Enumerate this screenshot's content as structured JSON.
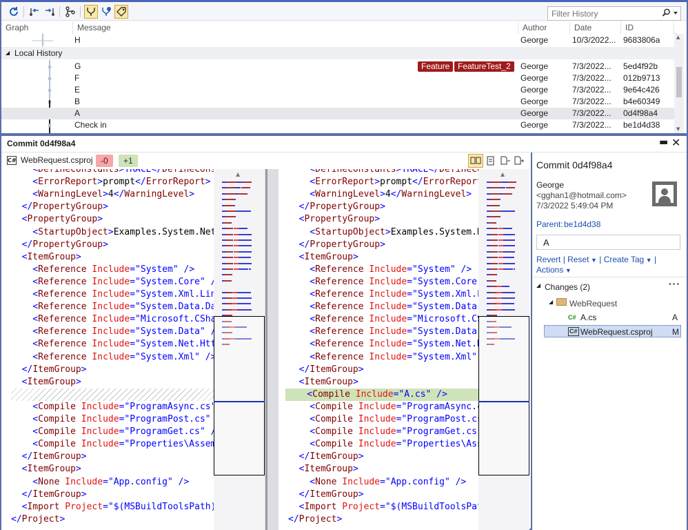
{
  "toolbar": {
    "filter_placeholder": "Filter History",
    "icons": [
      "refresh-icon",
      "go-to-parent-icon",
      "go-to-child-icon",
      "branch-graph-icon",
      "show-remote-icon",
      "show-local-icon",
      "show-tags-icon",
      "search-icon"
    ]
  },
  "history": {
    "columns": [
      "Graph",
      "Message",
      "Author",
      "Date",
      "ID"
    ],
    "top_row": {
      "message": "H",
      "author": "George",
      "date": "10/3/2022...",
      "id": "9683806a"
    },
    "group_label": "Local History",
    "rows": [
      {
        "message": "G",
        "author": "George",
        "date": "7/3/2022...",
        "id": "5ed4f92b",
        "tags": [
          "Feature",
          "FeatureTest_2"
        ]
      },
      {
        "message": "F",
        "author": "George",
        "date": "7/3/2022...",
        "id": "012b9713",
        "tags": []
      },
      {
        "message": "E",
        "author": "George",
        "date": "7/3/2022...",
        "id": "9e64c426",
        "tags": []
      },
      {
        "message": "B",
        "author": "George",
        "date": "7/3/2022...",
        "id": "b4e60349",
        "tags": []
      },
      {
        "message": "A",
        "author": "George",
        "date": "7/3/2022...",
        "id": "0d4f98a4",
        "tags": [],
        "selected": true
      },
      {
        "message": "Check in",
        "author": "George",
        "date": "7/3/2022...",
        "id": "be1d4d38",
        "tags": []
      }
    ]
  },
  "commit_panel": {
    "title": "Commit 0d4f98a4",
    "file_name": "WebRequest.csproj",
    "removed_badge": "-0",
    "added_badge": "+1"
  },
  "diff": {
    "left": [
      [
        [
          "    <",
          "b"
        ],
        [
          "DefineConstants",
          "k"
        ],
        [
          ">TRACE</",
          "b"
        ],
        [
          "DefineConst",
          "k"
        ]
      ],
      [
        [
          "    <",
          "b"
        ],
        [
          "ErrorReport",
          "k"
        ],
        [
          ">",
          "b"
        ],
        [
          "prompt",
          "tx"
        ],
        [
          "</",
          "b"
        ],
        [
          "ErrorReport",
          "k"
        ],
        [
          ">",
          "b"
        ]
      ],
      [
        [
          "    <",
          "b"
        ],
        [
          "WarningLevel",
          "k"
        ],
        [
          ">",
          "b"
        ],
        [
          "4",
          "tx"
        ],
        [
          "</",
          "b"
        ],
        [
          "WarningLevel",
          "k"
        ],
        [
          ">",
          "b"
        ]
      ],
      [
        [
          "  </",
          "b"
        ],
        [
          "PropertyGroup",
          "k"
        ],
        [
          ">",
          "b"
        ]
      ],
      [
        [
          "  <",
          "b"
        ],
        [
          "PropertyGroup",
          "k"
        ],
        [
          ">",
          "b"
        ]
      ],
      [
        [
          "    <",
          "b"
        ],
        [
          "StartupObject",
          "k"
        ],
        [
          ">",
          "b"
        ],
        [
          "Examples.System.Net",
          "tx"
        ]
      ],
      [
        [
          "  </",
          "b"
        ],
        [
          "PropertyGroup",
          "k"
        ],
        [
          ">",
          "b"
        ]
      ],
      [
        [
          "  <",
          "b"
        ],
        [
          "ItemGroup",
          "k"
        ],
        [
          ">",
          "b"
        ]
      ],
      [
        [
          "    <",
          "b"
        ],
        [
          "Reference",
          "k"
        ],
        [
          " ",
          "tx"
        ],
        [
          "Include",
          "a"
        ],
        [
          "=",
          "b"
        ],
        [
          "\"System\"",
          "s"
        ],
        [
          " />",
          "b"
        ]
      ],
      [
        [
          "    <",
          "b"
        ],
        [
          "Reference",
          "k"
        ],
        [
          " ",
          "tx"
        ],
        [
          "Include",
          "a"
        ],
        [
          "=",
          "b"
        ],
        [
          "\"System.Core\"",
          "s"
        ],
        [
          " />",
          "b"
        ]
      ],
      [
        [
          "    <",
          "b"
        ],
        [
          "Reference",
          "k"
        ],
        [
          " ",
          "tx"
        ],
        [
          "Include",
          "a"
        ],
        [
          "=",
          "b"
        ],
        [
          "\"System.Xml.Linq",
          "s"
        ]
      ],
      [
        [
          "    <",
          "b"
        ],
        [
          "Reference",
          "k"
        ],
        [
          " ",
          "tx"
        ],
        [
          "Include",
          "a"
        ],
        [
          "=",
          "b"
        ],
        [
          "\"System.Data.Dat",
          "s"
        ]
      ],
      [
        [
          "    <",
          "b"
        ],
        [
          "Reference",
          "k"
        ],
        [
          " ",
          "tx"
        ],
        [
          "Include",
          "a"
        ],
        [
          "=",
          "b"
        ],
        [
          "\"Microsoft.CShar",
          "s"
        ]
      ],
      [
        [
          "    <",
          "b"
        ],
        [
          "Reference",
          "k"
        ],
        [
          " ",
          "tx"
        ],
        [
          "Include",
          "a"
        ],
        [
          "=",
          "b"
        ],
        [
          "\"System.Data\"",
          "s"
        ],
        [
          " /",
          "b"
        ]
      ],
      [
        [
          "    <",
          "b"
        ],
        [
          "Reference",
          "k"
        ],
        [
          " ",
          "tx"
        ],
        [
          "Include",
          "a"
        ],
        [
          "=",
          "b"
        ],
        [
          "\"System.Net.Http",
          "s"
        ]
      ],
      [
        [
          "    <",
          "b"
        ],
        [
          "Reference",
          "k"
        ],
        [
          " ",
          "tx"
        ],
        [
          "Include",
          "a"
        ],
        [
          "=",
          "b"
        ],
        [
          "\"System.Xml\"",
          "s"
        ],
        [
          " />",
          "b"
        ]
      ],
      [
        [
          "  </",
          "b"
        ],
        [
          "ItemGroup",
          "k"
        ],
        [
          ">",
          "b"
        ]
      ],
      [
        [
          "  <",
          "b"
        ],
        [
          "ItemGroup",
          "k"
        ],
        [
          ">",
          "b"
        ]
      ],
      [],
      [
        [
          "    <",
          "b"
        ],
        [
          "Compile",
          "k"
        ],
        [
          " ",
          "tx"
        ],
        [
          "Include",
          "a"
        ],
        [
          "=",
          "b"
        ],
        [
          "\"ProgramAsync.cs\"",
          "s"
        ]
      ],
      [
        [
          "    <",
          "b"
        ],
        [
          "Compile",
          "k"
        ],
        [
          " ",
          "tx"
        ],
        [
          "Include",
          "a"
        ],
        [
          "=",
          "b"
        ],
        [
          "\"ProgramPost.cs\"",
          "s"
        ],
        [
          " /",
          "b"
        ]
      ],
      [
        [
          "    <",
          "b"
        ],
        [
          "Compile",
          "k"
        ],
        [
          " ",
          "tx"
        ],
        [
          "Include",
          "a"
        ],
        [
          "=",
          "b"
        ],
        [
          "\"ProgramGet.cs\"",
          "s"
        ],
        [
          " /",
          "b"
        ]
      ],
      [
        [
          "    <",
          "b"
        ],
        [
          "Compile",
          "k"
        ],
        [
          " ",
          "tx"
        ],
        [
          "Include",
          "a"
        ],
        [
          "=",
          "b"
        ],
        [
          "\"Properties\\AssemB",
          "s"
        ]
      ],
      [
        [
          "  </",
          "b"
        ],
        [
          "ItemGroup",
          "k"
        ],
        [
          ">",
          "b"
        ]
      ],
      [
        [
          "  <",
          "b"
        ],
        [
          "ItemGroup",
          "k"
        ],
        [
          ">",
          "b"
        ]
      ],
      [
        [
          "    <",
          "b"
        ],
        [
          "None",
          "k"
        ],
        [
          " ",
          "tx"
        ],
        [
          "Include",
          "a"
        ],
        [
          "=",
          "b"
        ],
        [
          "\"App.config\"",
          "s"
        ],
        [
          " />",
          "b"
        ]
      ],
      [
        [
          "  </",
          "b"
        ],
        [
          "ItemGroup",
          "k"
        ],
        [
          ">",
          "b"
        ]
      ],
      [
        [
          "  <",
          "b"
        ],
        [
          "Import",
          "k"
        ],
        [
          " ",
          "tx"
        ],
        [
          "Project",
          "a"
        ],
        [
          "=",
          "b"
        ],
        [
          "\"$(MSBuildToolsPath)\"",
          "s"
        ]
      ],
      [
        [
          "</",
          "b"
        ],
        [
          "Project",
          "k"
        ],
        [
          ">",
          "b"
        ]
      ]
    ],
    "right": [
      [
        [
          "    <",
          "b"
        ],
        [
          "DefineConstants",
          "k"
        ],
        [
          ">TRACE</",
          "b"
        ],
        [
          "DefineConst",
          "k"
        ]
      ],
      [
        [
          "    <",
          "b"
        ],
        [
          "ErrorReport",
          "k"
        ],
        [
          ">",
          "b"
        ],
        [
          "prompt",
          "tx"
        ],
        [
          "</",
          "b"
        ],
        [
          "ErrorReport",
          "k"
        ],
        [
          ">",
          "b"
        ]
      ],
      [
        [
          "    <",
          "b"
        ],
        [
          "WarningLevel",
          "k"
        ],
        [
          ">",
          "b"
        ],
        [
          "4",
          "tx"
        ],
        [
          "</",
          "b"
        ],
        [
          "WarningLevel",
          "k"
        ],
        [
          ">",
          "b"
        ]
      ],
      [
        [
          "  </",
          "b"
        ],
        [
          "PropertyGroup",
          "k"
        ],
        [
          ">",
          "b"
        ]
      ],
      [
        [
          "  <",
          "b"
        ],
        [
          "PropertyGroup",
          "k"
        ],
        [
          ">",
          "b"
        ]
      ],
      [
        [
          "    <",
          "b"
        ],
        [
          "StartupObject",
          "k"
        ],
        [
          ">",
          "b"
        ],
        [
          "Examples.System.Ne",
          "tx"
        ]
      ],
      [
        [
          "  </",
          "b"
        ],
        [
          "PropertyGroup",
          "k"
        ],
        [
          ">",
          "b"
        ]
      ],
      [
        [
          "  <",
          "b"
        ],
        [
          "ItemGroup",
          "k"
        ],
        [
          ">",
          "b"
        ]
      ],
      [
        [
          "    <",
          "b"
        ],
        [
          "Reference",
          "k"
        ],
        [
          " ",
          "tx"
        ],
        [
          "Include",
          "a"
        ],
        [
          "=",
          "b"
        ],
        [
          "\"System\"",
          "s"
        ],
        [
          " />",
          "b"
        ]
      ],
      [
        [
          "    <",
          "b"
        ],
        [
          "Reference",
          "k"
        ],
        [
          " ",
          "tx"
        ],
        [
          "Include",
          "a"
        ],
        [
          "=",
          "b"
        ],
        [
          "\"System.Core\"",
          "s"
        ],
        [
          " ",
          "b"
        ]
      ],
      [
        [
          "    <",
          "b"
        ],
        [
          "Reference",
          "k"
        ],
        [
          " ",
          "tx"
        ],
        [
          "Include",
          "a"
        ],
        [
          "=",
          "b"
        ],
        [
          "\"System.Xml.Li",
          "s"
        ]
      ],
      [
        [
          "    <",
          "b"
        ],
        [
          "Reference",
          "k"
        ],
        [
          " ",
          "tx"
        ],
        [
          "Include",
          "a"
        ],
        [
          "=",
          "b"
        ],
        [
          "\"System.Data.D",
          "s"
        ]
      ],
      [
        [
          "    <",
          "b"
        ],
        [
          "Reference",
          "k"
        ],
        [
          " ",
          "tx"
        ],
        [
          "Include",
          "a"
        ],
        [
          "=",
          "b"
        ],
        [
          "\"Microsoft.CSh",
          "s"
        ]
      ],
      [
        [
          "    <",
          "b"
        ],
        [
          "Reference",
          "k"
        ],
        [
          " ",
          "tx"
        ],
        [
          "Include",
          "a"
        ],
        [
          "=",
          "b"
        ],
        [
          "\"System.Data\"",
          "s"
        ]
      ],
      [
        [
          "    <",
          "b"
        ],
        [
          "Reference",
          "k"
        ],
        [
          " ",
          "tx"
        ],
        [
          "Include",
          "a"
        ],
        [
          "=",
          "b"
        ],
        [
          "\"System.Net.Ht",
          "s"
        ]
      ],
      [
        [
          "    <",
          "b"
        ],
        [
          "Reference",
          "k"
        ],
        [
          " ",
          "tx"
        ],
        [
          "Include",
          "a"
        ],
        [
          "=",
          "b"
        ],
        [
          "\"System.Xml\"",
          "s"
        ],
        [
          " /",
          "b"
        ]
      ],
      [
        [
          "  </",
          "b"
        ],
        [
          "ItemGroup",
          "k"
        ],
        [
          ">",
          "b"
        ]
      ],
      [
        [
          "  <",
          "b"
        ],
        [
          "ItemGroup",
          "k"
        ],
        [
          ">",
          "b"
        ]
      ],
      [
        [
          "    <",
          "b"
        ],
        [
          "Compile",
          "k"
        ],
        [
          " ",
          "tx"
        ],
        [
          "Include",
          "a"
        ],
        [
          "=",
          "b"
        ],
        [
          "\"A.cs\"",
          "s"
        ],
        [
          " />",
          "b"
        ]
      ],
      [
        [
          "    <",
          "b"
        ],
        [
          "Compile",
          "k"
        ],
        [
          " ",
          "tx"
        ],
        [
          "Include",
          "a"
        ],
        [
          "=",
          "b"
        ],
        [
          "\"ProgramAsync.cs",
          "s"
        ]
      ],
      [
        [
          "    <",
          "b"
        ],
        [
          "Compile",
          "k"
        ],
        [
          " ",
          "tx"
        ],
        [
          "Include",
          "a"
        ],
        [
          "=",
          "b"
        ],
        [
          "\"ProgramPost.cs\"",
          "s"
        ]
      ],
      [
        [
          "    <",
          "b"
        ],
        [
          "Compile",
          "k"
        ],
        [
          " ",
          "tx"
        ],
        [
          "Include",
          "a"
        ],
        [
          "=",
          "b"
        ],
        [
          "\"ProgramGet.cs\"",
          "s"
        ]
      ],
      [
        [
          "    <",
          "b"
        ],
        [
          "Compile",
          "k"
        ],
        [
          " ",
          "tx"
        ],
        [
          "Include",
          "a"
        ],
        [
          "=",
          "b"
        ],
        [
          "\"Properties\\Asse",
          "s"
        ]
      ],
      [
        [
          "  </",
          "b"
        ],
        [
          "ItemGroup",
          "k"
        ],
        [
          ">",
          "b"
        ]
      ],
      [
        [
          "  <",
          "b"
        ],
        [
          "ItemGroup",
          "k"
        ],
        [
          ">",
          "b"
        ]
      ],
      [
        [
          "    <",
          "b"
        ],
        [
          "None",
          "k"
        ],
        [
          " ",
          "tx"
        ],
        [
          "Include",
          "a"
        ],
        [
          "=",
          "b"
        ],
        [
          "\"App.config\"",
          "s"
        ],
        [
          " />",
          "b"
        ]
      ],
      [
        [
          "  </",
          "b"
        ],
        [
          "ItemGroup",
          "k"
        ],
        [
          ">",
          "b"
        ]
      ],
      [
        [
          "  <",
          "b"
        ],
        [
          "Import",
          "k"
        ],
        [
          " ",
          "tx"
        ],
        [
          "Project",
          "a"
        ],
        [
          "=",
          "b"
        ],
        [
          "\"$(MSBuildToolsPath",
          "s"
        ]
      ],
      [
        [
          "</",
          "b"
        ],
        [
          "Project",
          "k"
        ],
        [
          ">",
          "b"
        ]
      ]
    ]
  },
  "details": {
    "title": "Commit 0d4f98a4",
    "author": "George",
    "email": "<gghan1@hotmail.com>",
    "date": "7/3/2022 5:49:04 PM",
    "parent_label": "Parent:",
    "parent_id": "be1d4d38",
    "message": "A",
    "actions": {
      "revert": "Revert",
      "reset": "Reset",
      "create_tag": "Create Tag",
      "more": "Actions"
    },
    "changes_label": "Changes (2)",
    "folder": "WebRequest",
    "files": [
      {
        "name": "A.cs",
        "status": "A",
        "icon": "csharp-file-icon"
      },
      {
        "name": "WebRequest.csproj",
        "status": "M",
        "icon": "csharp-project-icon",
        "selected": true
      }
    ]
  },
  "colors": {
    "accent": "#5a6fa8",
    "tag": "#a01b1b",
    "removed": "#f4a8a8",
    "added": "#cfe3b8",
    "link": "#1a4fb0"
  }
}
